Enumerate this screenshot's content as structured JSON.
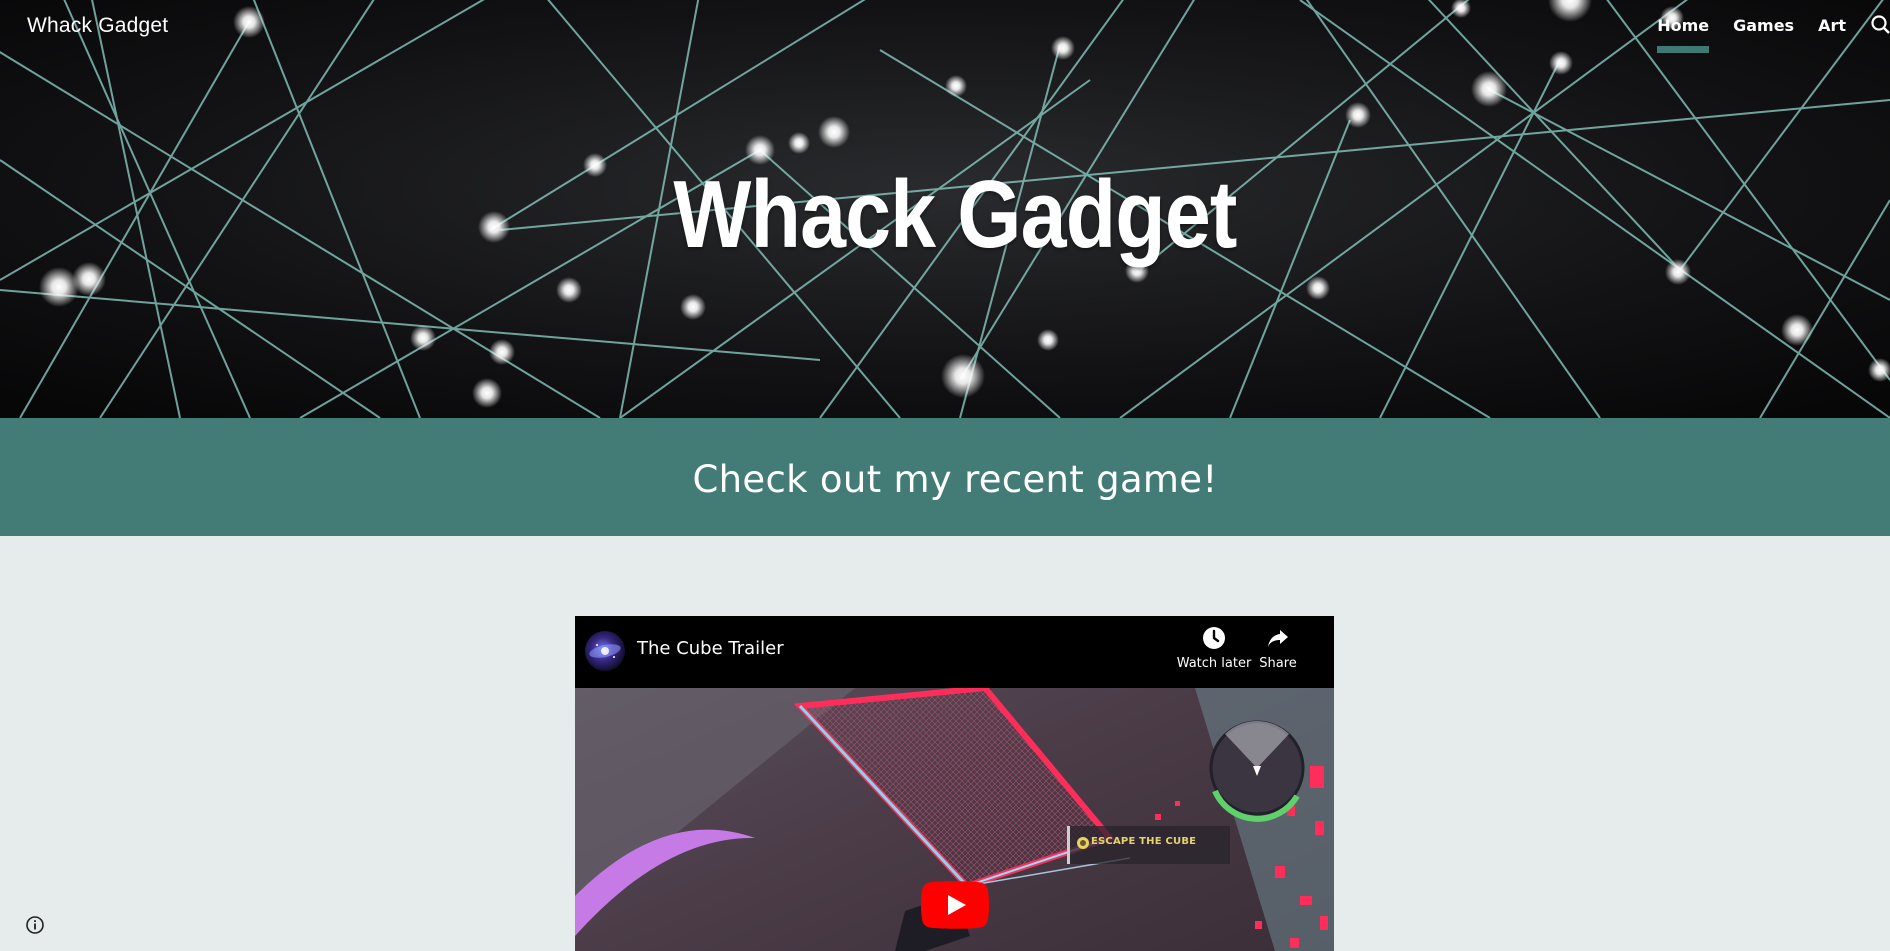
{
  "header": {
    "site_name": "Whack Gadget",
    "nav": [
      {
        "label": "Home",
        "active": true
      },
      {
        "label": "Games",
        "active": false
      },
      {
        "label": "Art",
        "active": false
      }
    ],
    "search_icon": "search-icon"
  },
  "hero": {
    "title": "Whack Gadget"
  },
  "banner": {
    "text": "Check out my recent game!"
  },
  "video": {
    "title": "The Cube Trailer",
    "watch_later_label": "Watch later",
    "share_label": "Share",
    "hud_label": "ESCAPE THE CUBE",
    "icons": [
      "clock-icon",
      "share-arrow-icon",
      "youtube-play-icon"
    ]
  },
  "colors": {
    "accent": "#437b76",
    "page_background": "#e6ebec",
    "play_red": "#ff0000"
  },
  "footer": {
    "info_icon": "info-icon"
  }
}
